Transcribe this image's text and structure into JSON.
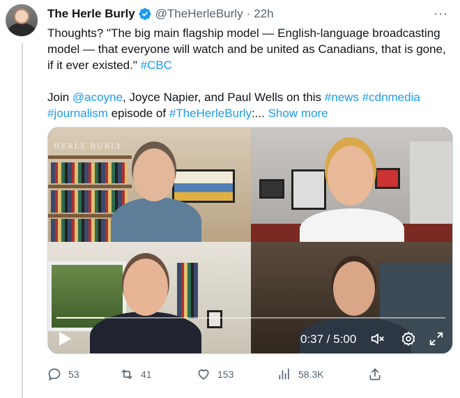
{
  "tweet": {
    "author_name": "The Herle Burly",
    "handle": "@TheHerleBurly",
    "separator": "·",
    "time": "22h",
    "more_label": "···",
    "text": {
      "line1_part1": "Thoughts? \"The big main flagship model — English-language broadcasting model — that everyone will watch and be united as Canadians, that is gone, if it ever existed.\" ",
      "hashtag_cbc": "#CBC",
      "line2_join": "Join ",
      "mention_acoyne": "@acoyne",
      "line2_mid": ", Joyce Napier, and Paul Wells on this ",
      "hashtag_news": "#news",
      "space": " ",
      "hashtag_cdnmedia": "#cdnmedia",
      "hashtag_journalism": "#journalism",
      "line3_mid": " episode of ",
      "hashtag_herleburly": "#TheHerleBurly",
      "line3_end": ":... ",
      "show_more": "Show more"
    }
  },
  "video": {
    "watermark": "HERLE BURLY",
    "time_display": "0:37 / 5:00",
    "progress": 0.123,
    "icons": [
      "play-icon",
      "mute-icon",
      "settings-icon",
      "fullscreen-icon"
    ]
  },
  "actions": {
    "replies": "53",
    "reposts": "41",
    "likes": "153",
    "views": "58.3K"
  },
  "colors": {
    "accent": "#1d9bf0",
    "secondary_text": "#536471",
    "primary_text": "#0f1419",
    "verified": "#1d9bf0"
  }
}
